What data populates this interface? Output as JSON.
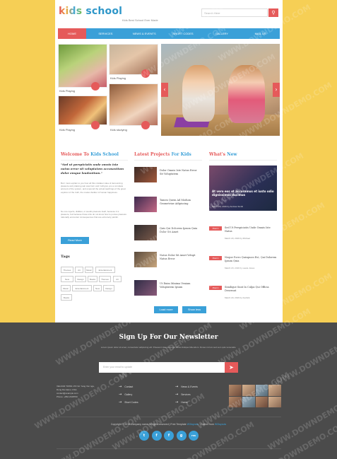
{
  "header": {
    "logo_kids": "kids",
    "logo_school": "school",
    "tagline": "Kids Best School Ever Made",
    "search_placeholder": "Search Here"
  },
  "nav": {
    "items": [
      "HOME",
      "SERVICES",
      "NEWS & EVENTS",
      "SHORT CODES",
      "GALLERY",
      "MAIL US"
    ]
  },
  "thumbs": {
    "cap1": "Kids Playing",
    "cap2": "Kids Playing",
    "cap3": "Kids Playing",
    "cap4": "Kids studying"
  },
  "welcome": {
    "title_a": "Welcome To",
    "title_b": "Kids School",
    "quote": "\"Sed ut perspiciatis unde omnis iste natus error sit voluptatem accusantium dolor emque laudantium.\"",
    "p1": "But I must explain to you how all this mistaken idea of denouncing pleasure and praising pain was born and I will give you a complete account of the system, and expound the actual teachings of the great explorer of the truth, the master-builder of human happiness.",
    "p2": "No one rejects, dislikes, or avoids pleasure itself, because it is pleasure, but because those who do not know how to pursue pleasure rationally encounter consequences that are extremely painful.",
    "read_more": "Read More"
  },
  "tags": {
    "title": "Tags",
    "items": [
      "Themes",
      "Art",
      "Music",
      "Entertainment",
      "New",
      "Design",
      "Books",
      "Themes",
      "Art",
      "Music",
      "Entertainment",
      "New",
      "Design",
      "Books"
    ]
  },
  "projects": {
    "title_a": "Latest Projects",
    "title_b": "For Kids",
    "items": [
      "Dolor Omnis Iste Natus Error Sit Voluptatem",
      "Tamen Quem Ad Modum Geometriae Adipiscing",
      "Quis Qui Dolorem Ipsum Quia Dolor Sit Amet",
      "Natus Dolor Sit Amet Volupt Natus Error",
      "Ut Enim Minima Veniam Voluptatem Ipsum"
    ],
    "load_more": "Load more",
    "show_less": "Show less"
  },
  "news": {
    "title_a": "What's",
    "title_b": "New",
    "featured_title": "At vero eos et accusamus et iusto odio dignissimos ducimus",
    "featured_meta": "March 20, 2016 by Andrew Smith",
    "badge": "Post 1",
    "items": [
      {
        "title": "Sed Ut Perspiciatis Unde Omnis Iste Natus",
        "meta": "March 20, 2016 by Michael"
      },
      {
        "title": "Neque Porro Quisquam Est, Qui Dolorem Ipsum Quia",
        "meta": "March 20, 2016 by Laura Jones"
      },
      {
        "title": "Similique Sunt In Culpa Qui Officia Deserunt",
        "meta": "March 20, 2016 by Fedrick"
      }
    ]
  },
  "footer": {
    "title": "Sign Up For Our Newsletter",
    "text": "Lorem ipsum dolor sit amet, consectetur adipiscing elit. Praesent vitae sed eget tellus tristique bibendum. Donec rutrum sed sem quis venenatis.",
    "email_placeholder": "Enter your email to update",
    "address": [
      "VELOUR TOWN LTD 3d. Yang Yan nga,",
      "Dong Da Hanoi, USA.",
      "contact@example.com",
      "Phone: +864 2348760"
    ],
    "links_a": [
      "Contact",
      "Gallery",
      "Short Codes"
    ],
    "links_b": [
      "News & Events",
      "Services",
      "Home"
    ],
    "copyright": "Copyright © 2016 Company name All rights reserved | Free Template",
    "copyright_link": "W3layouts",
    "copyright_tail": "· Collect from",
    "copyright_link2": "W3layouts",
    "socials": [
      "t",
      "f",
      "f",
      "g",
      "rss"
    ]
  },
  "watermark": "WWW.DOWNDEMO.COM",
  "colors": {
    "accent": "#e55a5a",
    "brand": "#3aa0d8",
    "background": "#f6cf55",
    "footer": "#4b4b4b"
  }
}
